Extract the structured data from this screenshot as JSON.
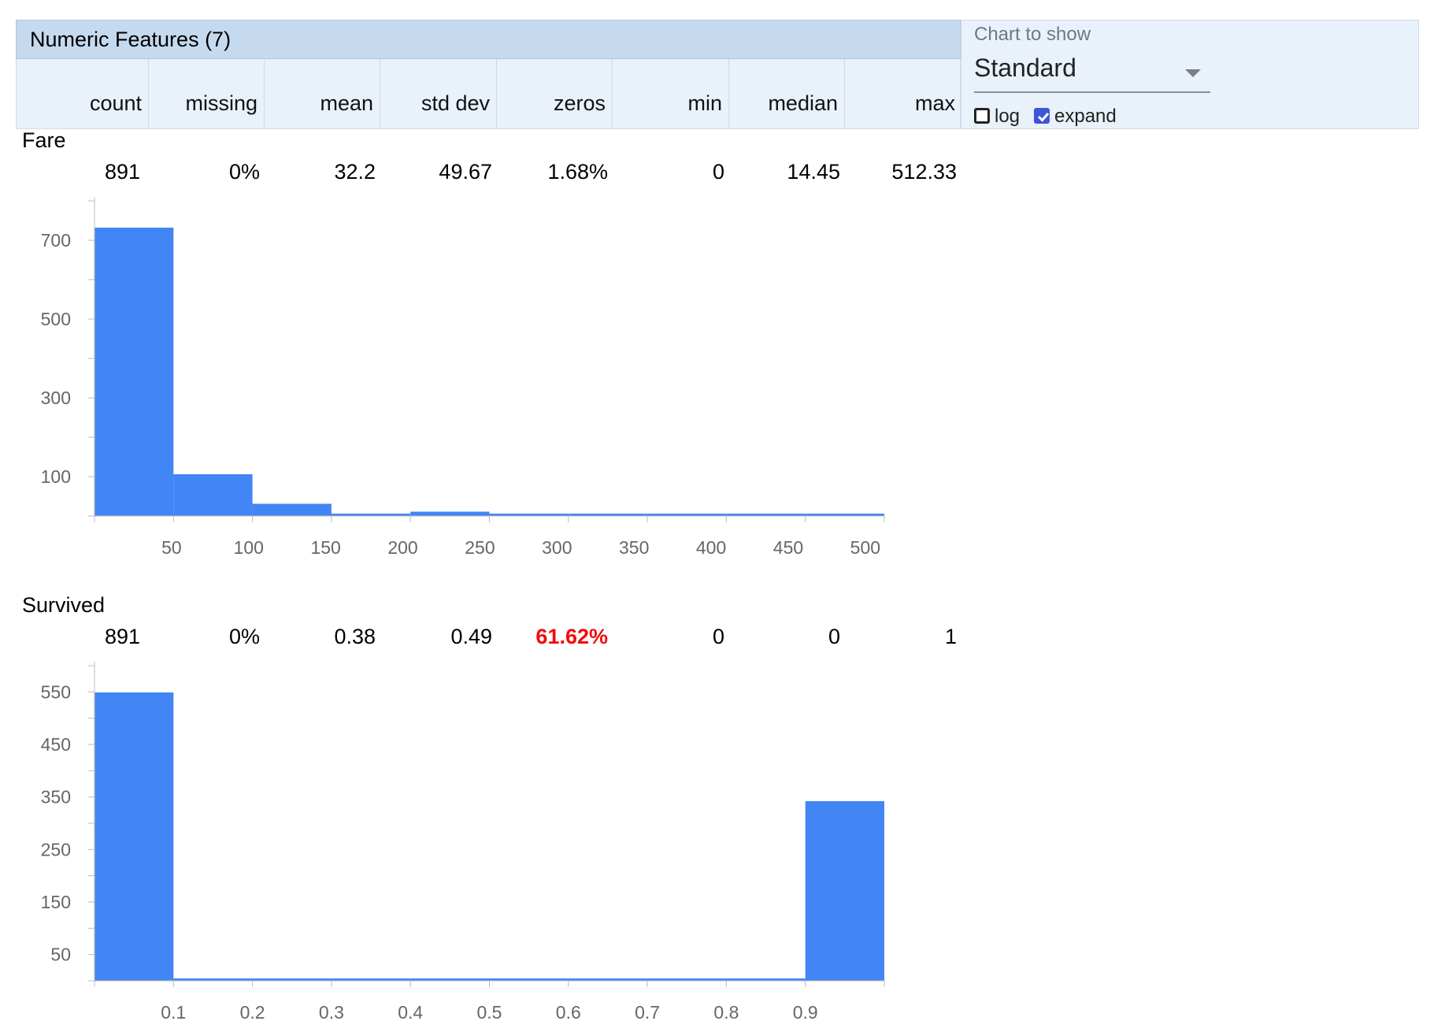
{
  "header": {
    "title": "Numeric Features (7)",
    "columns": [
      "count",
      "missing",
      "mean",
      "std dev",
      "zeros",
      "min",
      "median",
      "max"
    ]
  },
  "controls": {
    "chart_label": "Chart to show",
    "chart_value": "Standard",
    "log": {
      "label": "log",
      "checked": false
    },
    "expand": {
      "label": "expand",
      "checked": true
    }
  },
  "features": [
    {
      "name": "Fare",
      "stats": {
        "count": "891",
        "missing": "0%",
        "mean": "32.2",
        "std_dev": "49.67",
        "zeros": "1.68%",
        "min": "0",
        "median": "14.45",
        "max": "512.33"
      },
      "zeros_highlight": false
    },
    {
      "name": "Survived",
      "stats": {
        "count": "891",
        "missing": "0%",
        "mean": "0.38",
        "std_dev": "0.49",
        "zeros": "61.62%",
        "min": "0",
        "median": "0",
        "max": "1"
      },
      "zeros_highlight": true
    }
  ],
  "colors": {
    "bar": "#4285f4",
    "warn": "#f10c0c",
    "header_dark": "#c6daef",
    "header_light": "#e9f1fa"
  },
  "chart_data": [
    {
      "type": "bar",
      "feature": "Fare",
      "xlim": [
        0,
        512.33
      ],
      "ylim": [
        0,
        800
      ],
      "bin_edges": [
        0,
        51.233,
        102.466,
        153.699,
        204.932,
        256.165,
        307.398,
        358.631,
        409.864,
        461.097,
        512.33
      ],
      "values": [
        732,
        106,
        31,
        2,
        11,
        6,
        0,
        0,
        0,
        3
      ],
      "x_ticks": [
        50,
        100,
        150,
        200,
        250,
        300,
        350,
        400,
        450,
        500
      ],
      "y_ticks": [
        100,
        300,
        500,
        700
      ],
      "y_minor_ticks": [
        0,
        100,
        200,
        300,
        400,
        500,
        600,
        700,
        800
      ]
    },
    {
      "type": "bar",
      "feature": "Survived",
      "xlim": [
        0,
        1
      ],
      "ylim": [
        0,
        600
      ],
      "bin_edges": [
        0,
        0.1,
        0.2,
        0.3,
        0.4,
        0.5,
        0.6,
        0.7,
        0.8,
        0.9,
        1
      ],
      "values": [
        549,
        0,
        0,
        0,
        0,
        0,
        0,
        0,
        0,
        342
      ],
      "x_ticks": [
        0.1,
        0.2,
        0.3,
        0.4,
        0.5,
        0.6,
        0.7,
        0.8,
        0.9
      ],
      "y_ticks": [
        50,
        150,
        250,
        350,
        450,
        550
      ],
      "y_minor_ticks": [
        0,
        50,
        100,
        150,
        200,
        250,
        300,
        350,
        400,
        450,
        500,
        550,
        600
      ]
    }
  ]
}
